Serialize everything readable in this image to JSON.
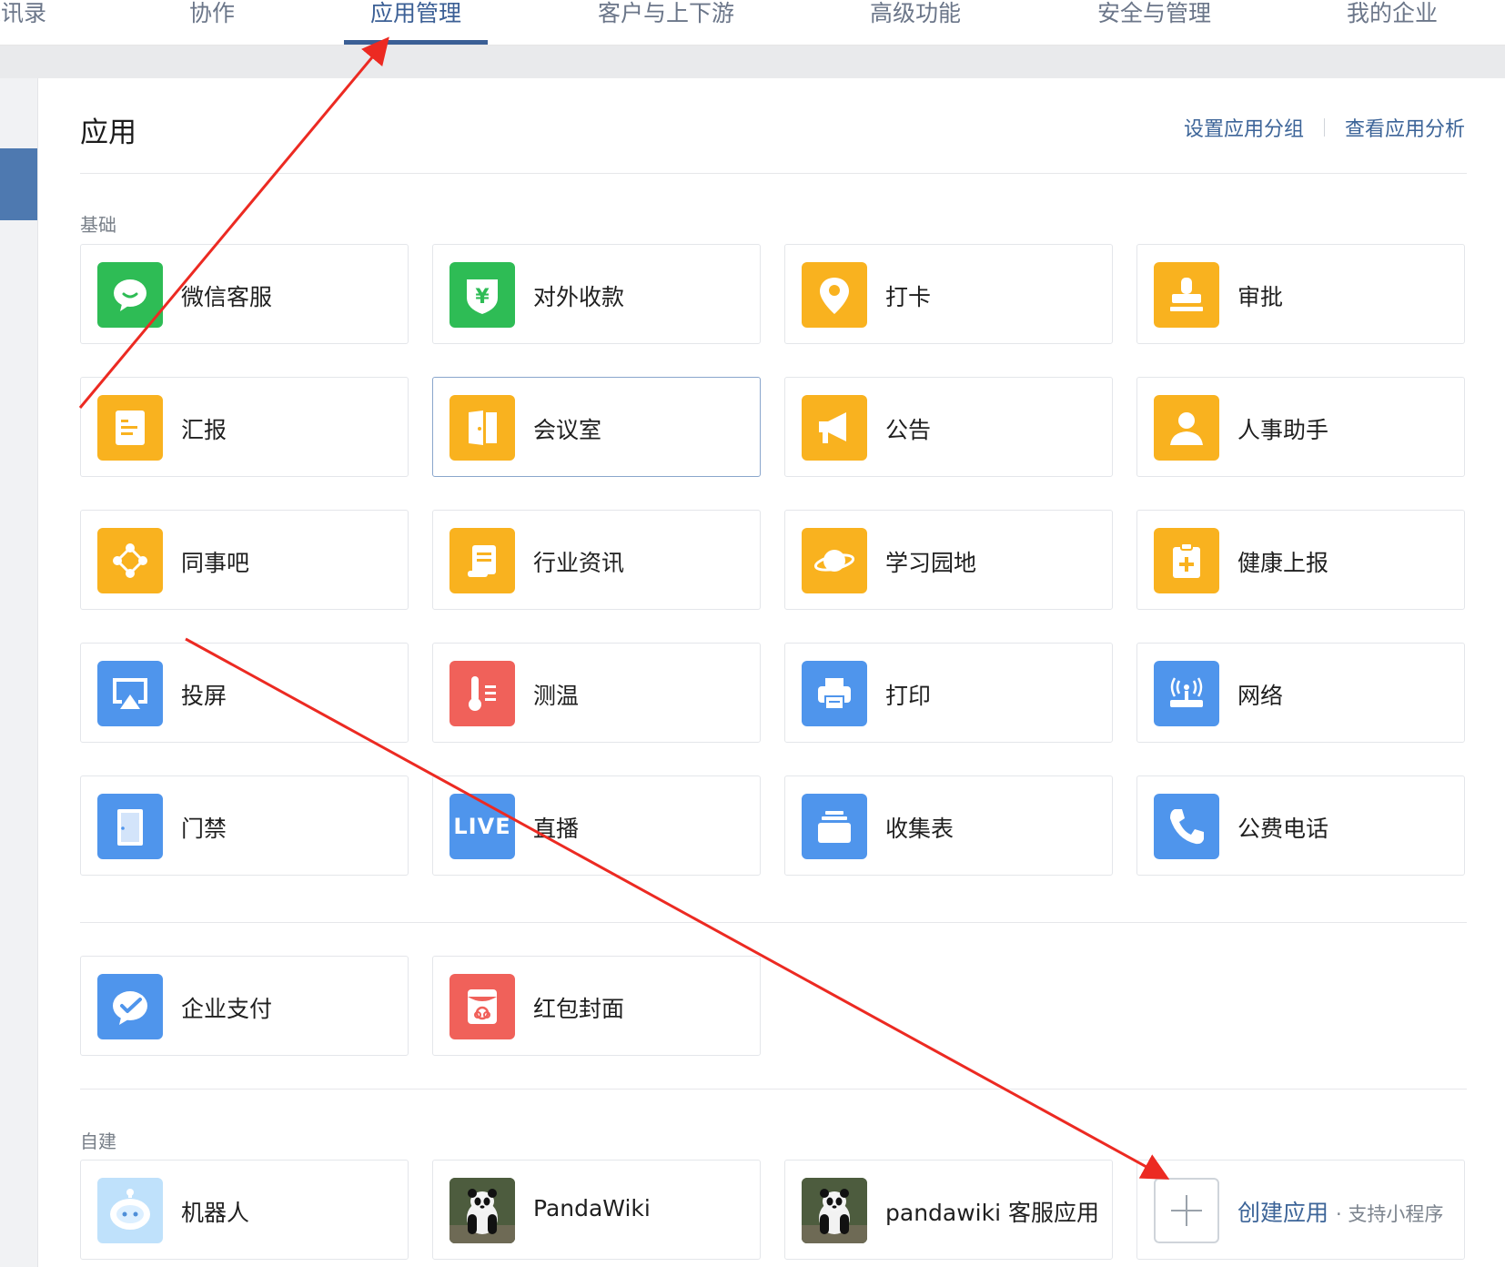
{
  "nav": {
    "tabs": [
      "通讯录",
      "协作",
      "应用管理",
      "客户与上下游",
      "高级功能",
      "安全与管理",
      "我的企业"
    ],
    "active": "应用管理"
  },
  "page": {
    "title": "应用",
    "link_groups": "设置应用分组",
    "link_analysis": "查看应用分析"
  },
  "sections": {
    "basic": "基础",
    "custom": "自建"
  },
  "basic_apps": [
    {
      "label": "微信客服",
      "icon": "wechat-chat-icon",
      "color": "#2ebc55"
    },
    {
      "label": "对外收款",
      "icon": "yuan-shield-icon",
      "color": "#2ebc55"
    },
    {
      "label": "打卡",
      "icon": "location-pin-icon",
      "color": "#f9b21f"
    },
    {
      "label": "审批",
      "icon": "stamp-icon",
      "color": "#f9b21f"
    },
    {
      "label": "汇报",
      "icon": "report-doc-icon",
      "color": "#f9b21f"
    },
    {
      "label": "会议室",
      "icon": "door-icon",
      "color": "#f9b21f"
    },
    {
      "label": "公告",
      "icon": "megaphone-icon",
      "color": "#f9b21f"
    },
    {
      "label": "人事助手",
      "icon": "person-icon",
      "color": "#f9b21f"
    },
    {
      "label": "同事吧",
      "icon": "network-icon",
      "color": "#f9b21f"
    },
    {
      "label": "行业资讯",
      "icon": "scroll-icon",
      "color": "#f9b21f"
    },
    {
      "label": "学习园地",
      "icon": "planet-icon",
      "color": "#f9b21f"
    },
    {
      "label": "健康上报",
      "icon": "medical-clipboard-icon",
      "color": "#f9b21f"
    },
    {
      "label": "投屏",
      "icon": "airplay-icon",
      "color": "#4f95ec"
    },
    {
      "label": "测温",
      "icon": "thermometer-icon",
      "color": "#f0615a"
    },
    {
      "label": "打印",
      "icon": "printer-icon",
      "color": "#4f95ec"
    },
    {
      "label": "网络",
      "icon": "router-icon",
      "color": "#4f95ec"
    },
    {
      "label": "门禁",
      "icon": "door-access-icon",
      "color": "#4f95ec"
    },
    {
      "label": "直播",
      "icon": "live-icon",
      "color": "#4f95ec",
      "icon_text": "LIVE"
    },
    {
      "label": "收集表",
      "icon": "stack-icon",
      "color": "#4f95ec"
    },
    {
      "label": "公费电话",
      "icon": "phone-icon",
      "color": "#4f95ec"
    }
  ],
  "pay_apps": [
    {
      "label": "企业支付",
      "icon": "wechat-pay-icon",
      "color": "#4f95ec"
    },
    {
      "label": "红包封面",
      "icon": "red-packet-icon",
      "color": "#f0615a"
    }
  ],
  "custom_apps": [
    {
      "label": "机器人",
      "icon": "robot-icon"
    },
    {
      "label": "PandaWiki",
      "icon": "panda-photo-icon"
    },
    {
      "label": "pandawiki 客服应用",
      "icon": "panda-photo-icon"
    }
  ],
  "create_app": {
    "label": "创建应用",
    "sub": "· 支持小程序"
  }
}
